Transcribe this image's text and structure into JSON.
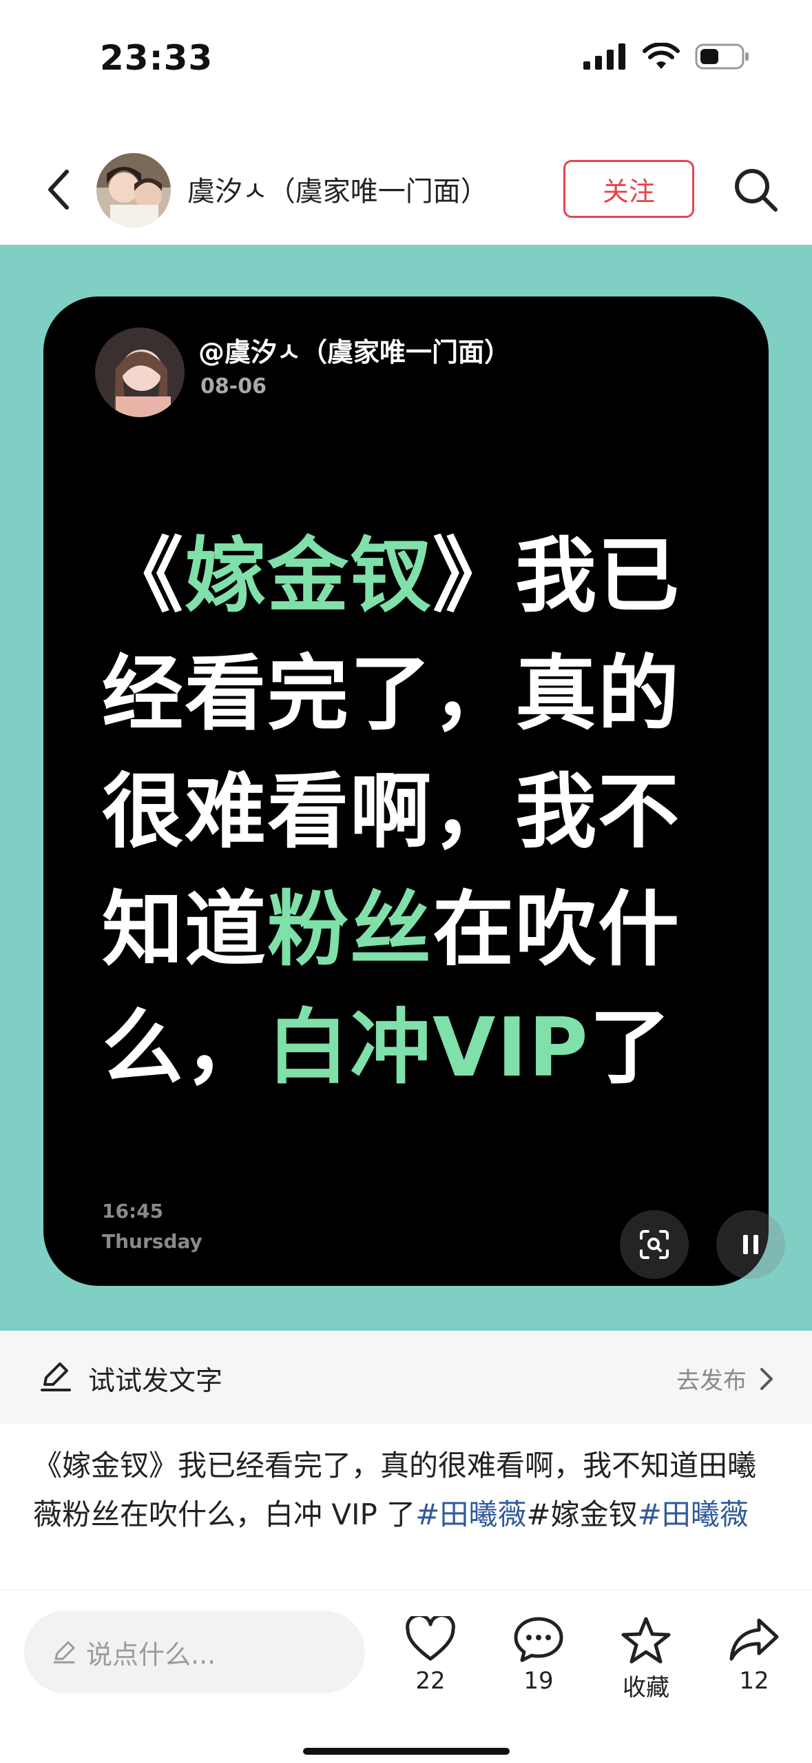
{
  "status_bar": {
    "time": "23:33"
  },
  "header": {
    "author_name": "虞汐ㅅ（虞家唯一门面）",
    "follow_label": "关注"
  },
  "post_card": {
    "handle": "@虞汐ㅅ（虞家唯一门面）",
    "date": "08-06",
    "text_segments": [
      {
        "text": "《",
        "highlight": false
      },
      {
        "text": "嫁金钗",
        "highlight": true
      },
      {
        "text": "》我已经看完了，真的很难看啊，我不知道",
        "highlight": false
      },
      {
        "text": "粉丝",
        "highlight": true
      },
      {
        "text": "在吹什么，",
        "highlight": false
      },
      {
        "text": "白冲VIP",
        "highlight": true
      },
      {
        "text": "了",
        "highlight": false
      }
    ],
    "time": "16:45",
    "weekday": "Thursday",
    "highlight_color": "#7fe0aa",
    "background_color": "#80cfc4"
  },
  "try_bar": {
    "label": "试试发文字",
    "action_label": "去发布"
  },
  "caption": {
    "text": "《嫁金钗》我已经看完了，真的很难看啊，我不知道田曦薇粉丝在吹什么，白冲 VIP 了",
    "tags": [
      "#田曦薇",
      "#嫁金钗",
      "#田曦薇"
    ]
  },
  "bottom_bar": {
    "comment_placeholder": "说点什么...",
    "likes": "22",
    "comments": "19",
    "favorite_label": "收藏",
    "shares": "12"
  },
  "icons": [
    "back-arrow-icon",
    "search-icon",
    "scan-icon",
    "pause-icon",
    "pen-icon",
    "chevron-right-icon",
    "heart-icon",
    "comment-icon",
    "star-icon",
    "share-icon",
    "signal-icon",
    "wifi-icon",
    "battery-icon"
  ]
}
